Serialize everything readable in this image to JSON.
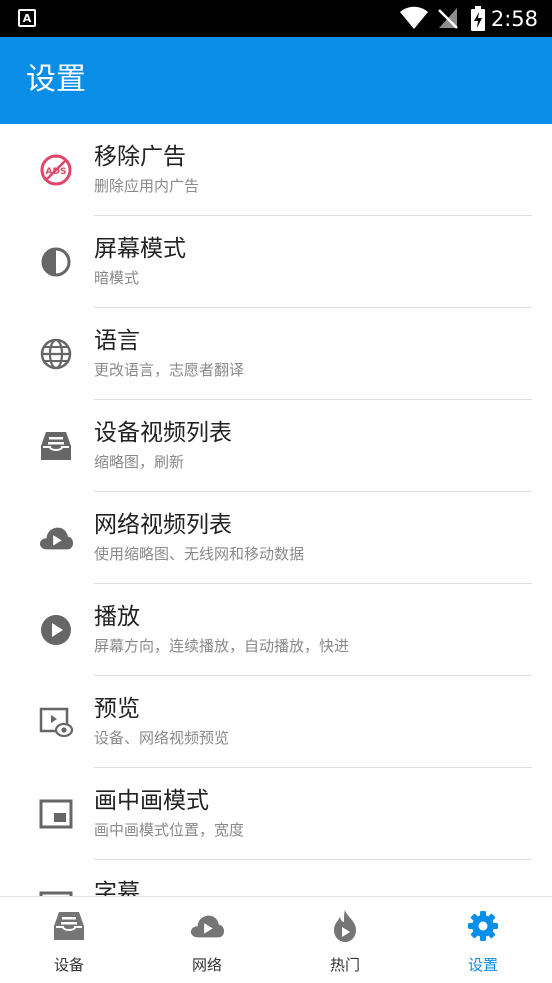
{
  "status_bar": {
    "app_badge": "A",
    "time": "2:58"
  },
  "app_bar": {
    "title": "设置"
  },
  "settings": {
    "items": [
      {
        "label": "移除广告",
        "sublabel": "删除应用内广告",
        "icon": "ads-off-icon"
      },
      {
        "label": "屏幕模式",
        "sublabel": "暗模式",
        "icon": "contrast-icon"
      },
      {
        "label": "语言",
        "sublabel": "更改语言，志愿者翻译",
        "icon": "globe-icon"
      },
      {
        "label": "设备视频列表",
        "sublabel": "缩略图，刷新",
        "icon": "inbox-tray-icon"
      },
      {
        "label": "网络视频列表",
        "sublabel": "使用缩略图、无线网和移动数据",
        "icon": "cloud-play-icon"
      },
      {
        "label": "播放",
        "sublabel": "屏幕方向，连续播放，自动播放，快进",
        "icon": "play-circle-icon"
      },
      {
        "label": "预览",
        "sublabel": "设备、网络视频预览",
        "icon": "preview-eye-icon"
      },
      {
        "label": "画中画模式",
        "sublabel": "画中画模式位置，宽度",
        "icon": "picture-in-picture-icon"
      },
      {
        "label": "字幕",
        "sublabel": "",
        "icon": "subtitles-icon"
      }
    ]
  },
  "bottom_nav": {
    "items": [
      {
        "label": "设备",
        "icon": "inbox-tray-icon"
      },
      {
        "label": "网络",
        "icon": "cloud-play-icon"
      },
      {
        "label": "热门",
        "icon": "flame-play-icon"
      },
      {
        "label": "设置",
        "icon": "gear-icon"
      }
    ],
    "active_index": 3
  },
  "colors": {
    "primary": "#0a8ee8",
    "ads_icon": "#e0466a",
    "icon_gray": "#666666",
    "nav_icon_gray": "#757575"
  }
}
